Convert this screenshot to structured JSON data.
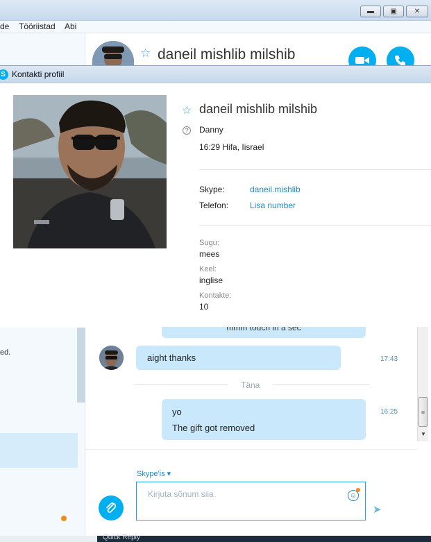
{
  "menu": {
    "items": [
      "de",
      "Tööriistad",
      "Abi"
    ]
  },
  "window_controls": {
    "minimize": "▬",
    "maximize": "▣",
    "close": "✕"
  },
  "header": {
    "name": "daneil mishlib milshib",
    "star": "☆",
    "video_icon": "video-call-icon",
    "call_icon": "phone-icon"
  },
  "sidebar": {
    "truncated_text": "ed."
  },
  "dialog": {
    "title": "Kontakti profiil",
    "logo": "S",
    "name": "daneil mishlib milshib",
    "star": "☆",
    "mood_icon": "?",
    "mood": "Danny",
    "local_time": "16:29 Hifa, Iisrael",
    "skype_label": "Skype:",
    "skype_value": "daneil.mishlib",
    "phone_label": "Telefon:",
    "phone_value": "Lisa number",
    "gender_label": "Sugu:",
    "gender_value": "mees",
    "language_label": "Keel:",
    "language_value": "inglise",
    "contacts_label": "Kontakte:",
    "contacts_value": "10"
  },
  "chat": {
    "partial_bubble": "mmm touch in a sec",
    "messages": [
      {
        "text": "aight thanks",
        "time": "17:43"
      }
    ],
    "day_label": "Täna",
    "outgoing": {
      "lines": [
        "yo",
        "The gift got removed"
      ],
      "time": "16:25"
    },
    "scroll_thumb": "≡",
    "scroll_down": "▼"
  },
  "composer": {
    "mode": "Skype'is ▾",
    "placeholder": "Kirjuta sõnum siia",
    "emoji": "☺",
    "attach": "📎",
    "send": "➤"
  },
  "taskbar": {
    "partial": "Quick Reply"
  },
  "colors": {
    "accent": "#00aff0",
    "bubble": "#c9e8fb",
    "link": "#1e88c7"
  }
}
